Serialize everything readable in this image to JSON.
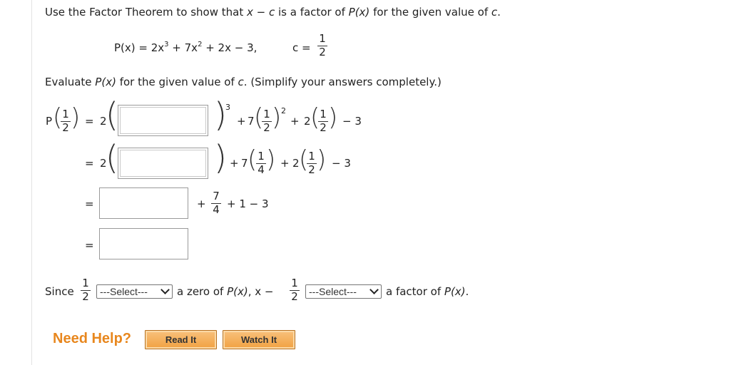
{
  "instructions": {
    "prefix": "Use the Factor Theorem to show that ",
    "x": "x",
    "minus": " − ",
    "c": "c",
    "mid": " is a factor of ",
    "Px": "P(x)",
    "suffix": " for the given value of ",
    "c2": "c",
    "end": "."
  },
  "polynomial": {
    "lhs": "P(x) = 2x",
    "exp3": "3",
    "plus7": " + 7x",
    "exp2": "2",
    "rest": " + 2x − 3,",
    "c_label": "c =",
    "c_num": "1",
    "c_den": "2"
  },
  "evaluate": {
    "prefix": "Evaluate ",
    "Px": "P(x)",
    "mid": " for the given value of ",
    "c": "c",
    "suffix": ". (Simplify your answers completely.)"
  },
  "steps": {
    "P": "P",
    "half_num": "1",
    "half_den": "2",
    "quarter_den": "4",
    "eq": "=",
    "two": "2",
    "seven": "7",
    "plus": "+",
    "minus3": "− 3",
    "exp3": "3",
    "exp2": "2",
    "seven_num": "7",
    "four_den": "4",
    "plus1minus3": "+ 1 − 3"
  },
  "answer_boxes": [
    {
      "value": ""
    },
    {
      "value": ""
    },
    {
      "value": ""
    },
    {
      "value": ""
    }
  ],
  "conclusion": {
    "since": "Since",
    "num": "1",
    "den": "2",
    "select1": "---Select---",
    "mid": "a zero of ",
    "Px": "P(x)",
    "comma_x": ", x −",
    "num2": "1",
    "den2": "2",
    "select2": "---Select---",
    "end": "a factor of ",
    "Px2": "P(x)",
    "period": "."
  },
  "help": {
    "label": "Need Help?",
    "read_it": "Read It",
    "watch_it": "Watch It"
  },
  "colors": {
    "accent": "#e8871e",
    "button": "#f4b05a",
    "text": "#222222"
  }
}
